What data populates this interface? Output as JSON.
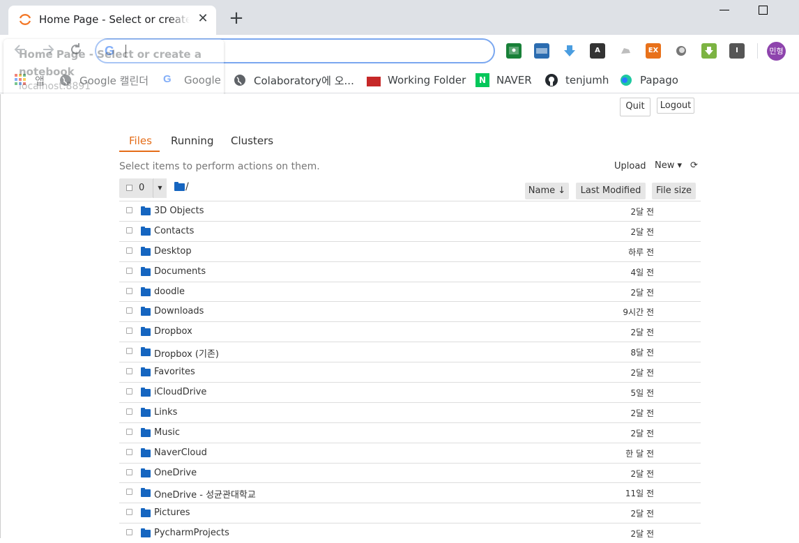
{
  "browser": {
    "tab_title": "Home Page - Select or create a notebook",
    "close_glyph": "✕",
    "new_tab_glyph": "+",
    "omnibox_value": "",
    "ghost_title": "Home Page - Select or create a notebook",
    "ghost_url": "localhost:8891",
    "profile_label": "민형",
    "extensions": [
      {
        "name": "classroom",
        "label": "",
        "color": "#188038"
      },
      {
        "name": "toolip",
        "label": "",
        "color": "#1a73e8"
      },
      {
        "name": "download",
        "label": "",
        "color": "#4a9de0"
      },
      {
        "name": "font",
        "label": "A",
        "color": "#333333"
      },
      {
        "name": "cloud",
        "label": "",
        "color": "#cccccc"
      },
      {
        "name": "ex",
        "label": "EX",
        "color": "#e8711a"
      },
      {
        "name": "circle",
        "label": "",
        "color": "#666666"
      },
      {
        "name": "download-green",
        "label": "",
        "color": "#7cb342"
      },
      {
        "name": "instapaper",
        "label": "I",
        "color": "#555555"
      }
    ]
  },
  "bookmarks": [
    {
      "label": "앱",
      "icon": "apps-grid-icon"
    },
    {
      "label": "Google 캘린더",
      "icon": "globe-icon"
    },
    {
      "label": "Google",
      "icon": "google-icon"
    },
    {
      "label": "Colaboratory에 오...",
      "icon": "globe-icon"
    },
    {
      "label": "Working Folder",
      "icon": "red-square-icon"
    },
    {
      "label": "NAVER",
      "icon": "naver-icon"
    },
    {
      "label": "tenjumh",
      "icon": "github-icon"
    },
    {
      "label": "Papago",
      "icon": "papago-icon"
    }
  ],
  "header": {
    "quit_label": "Quit",
    "logout_label": "Logout"
  },
  "tabs": {
    "files": "Files",
    "running": "Running",
    "clusters": "Clusters"
  },
  "toolbar": {
    "hint": "Select items to perform actions on them.",
    "upload": "Upload",
    "new": "New ▾",
    "refresh": "⟳",
    "selected_count": "0",
    "path": "/"
  },
  "columns": {
    "name": "Name ↓",
    "last_modified": "Last Modified",
    "file_size": "File size"
  },
  "files": [
    {
      "name": "3D Objects",
      "modified": "2달 전"
    },
    {
      "name": "Contacts",
      "modified": "2달 전"
    },
    {
      "name": "Desktop",
      "modified": "하루 전"
    },
    {
      "name": "Documents",
      "modified": "4일 전"
    },
    {
      "name": "doodle",
      "modified": "2달 전"
    },
    {
      "name": "Downloads",
      "modified": "9시간 전"
    },
    {
      "name": "Dropbox",
      "modified": "2달 전"
    },
    {
      "name": "Dropbox (기존)",
      "modified": "8달 전"
    },
    {
      "name": "Favorites",
      "modified": "2달 전"
    },
    {
      "name": "iCloudDrive",
      "modified": "5일 전"
    },
    {
      "name": "Links",
      "modified": "2달 전"
    },
    {
      "name": "Music",
      "modified": "2달 전"
    },
    {
      "name": "NaverCloud",
      "modified": "한 달 전"
    },
    {
      "name": "OneDrive",
      "modified": "2달 전"
    },
    {
      "name": "OneDrive - 성균관대학교",
      "modified": "11일 전"
    },
    {
      "name": "Pictures",
      "modified": "2달 전"
    },
    {
      "name": "PycharmProjects",
      "modified": "2달 전"
    }
  ]
}
